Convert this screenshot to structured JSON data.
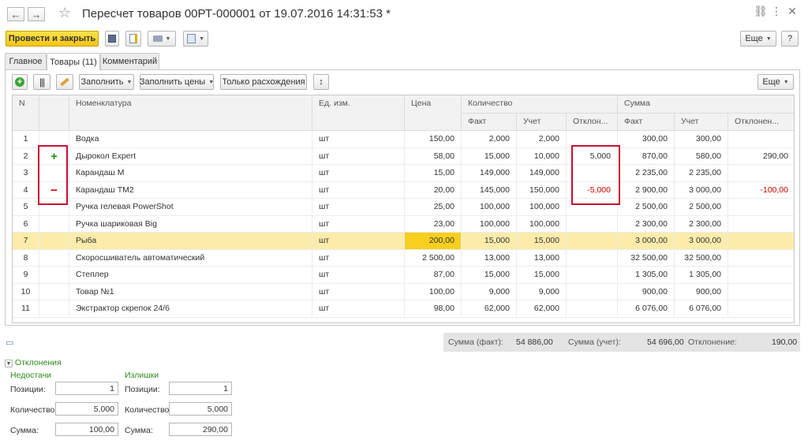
{
  "window": {
    "title": "Пересчет товаров 00РТ-000001 от 19.07.2016 14:31:53 *",
    "icons": [
      "link-icon",
      "menu-icon",
      "close-icon"
    ]
  },
  "toolbar": {
    "post_close": "Провести и закрыть",
    "more": "Еще",
    "help": "?"
  },
  "tabs": [
    {
      "label": "Главное",
      "active": false
    },
    {
      "label": "Товары (11)",
      "active": true
    },
    {
      "label": "Комментарий",
      "active": false
    }
  ],
  "table_toolbar": {
    "fill": "Заполнить",
    "fill_prices": "Заполнить цены",
    "only_diff": "Только расхождения",
    "more": "Еще"
  },
  "table": {
    "headers": {
      "n": "N",
      "nom": "Номенклатура",
      "unit": "Ед. изм.",
      "price": "Цена",
      "qty": "Количество",
      "qty_fact": "Факт",
      "qty_acc": "Учет",
      "qty_dev": "Отклон...",
      "sum": "Сумма",
      "sum_fact": "Факт",
      "sum_acc": "Учет",
      "sum_dev": "Отклонен..."
    },
    "rows": [
      {
        "n": "1",
        "mark": "",
        "nom": "Водка",
        "unit": "шт",
        "price": "150,00",
        "qf": "2,000",
        "qa": "2,000",
        "qd": "",
        "sf": "300,00",
        "sa": "300,00",
        "sd": ""
      },
      {
        "n": "2",
        "mark": "+",
        "nom": "Дырокол Expert",
        "unit": "шт",
        "price": "58,00",
        "qf": "15,000",
        "qa": "10,000",
        "qd": "5,000",
        "sf": "870,00",
        "sa": "580,00",
        "sd": "290,00"
      },
      {
        "n": "3",
        "mark": "",
        "nom": "Карандаш М",
        "unit": "шт",
        "price": "15,00",
        "qf": "149,000",
        "qa": "149,000",
        "qd": "",
        "sf": "2 235,00",
        "sa": "2 235,00",
        "sd": ""
      },
      {
        "n": "4",
        "mark": "−",
        "nom": "Карандаш ТМ2",
        "unit": "шт",
        "price": "20,00",
        "qf": "145,000",
        "qa": "150,000",
        "qd": "-5,000",
        "sf": "2 900,00",
        "sa": "3 000,00",
        "sd": "-100,00"
      },
      {
        "n": "5",
        "mark": "",
        "nom": "Ручка гелевая PowerShot",
        "unit": "шт",
        "price": "25,00",
        "qf": "100,000",
        "qa": "100,000",
        "qd": "",
        "sf": "2 500,00",
        "sa": "2 500,00",
        "sd": ""
      },
      {
        "n": "6",
        "mark": "",
        "nom": "Ручка шариковая Big",
        "unit": "шт",
        "price": "23,00",
        "qf": "100,000",
        "qa": "100,000",
        "qd": "",
        "sf": "2 300,00",
        "sa": "2 300,00",
        "sd": ""
      },
      {
        "n": "7",
        "mark": "",
        "nom": "Рыба",
        "unit": "шт",
        "price": "200,00",
        "qf": "15,000",
        "qa": "15,000",
        "qd": "",
        "sf": "3 000,00",
        "sa": "3 000,00",
        "sd": ""
      },
      {
        "n": "8",
        "mark": "",
        "nom": "Скоросшиватель автоматический",
        "unit": "шт",
        "price": "2 500,00",
        "qf": "13,000",
        "qa": "13,000",
        "qd": "",
        "sf": "32 500,00",
        "sa": "32 500,00",
        "sd": ""
      },
      {
        "n": "9",
        "mark": "",
        "nom": "Степлер",
        "unit": "шт",
        "price": "87,00",
        "qf": "15,000",
        "qa": "15,000",
        "qd": "",
        "sf": "1 305,00",
        "sa": "1 305,00",
        "sd": ""
      },
      {
        "n": "10",
        "mark": "",
        "nom": "Товар №1",
        "unit": "шт",
        "price": "100,00",
        "qf": "9,000",
        "qa": "9,000",
        "qd": "",
        "sf": "900,00",
        "sa": "900,00",
        "sd": ""
      },
      {
        "n": "11",
        "mark": "",
        "nom": "Экстрактор скрепок 24/6",
        "unit": "шт",
        "price": "98,00",
        "qf": "62,000",
        "qa": "62,000",
        "qd": "",
        "sf": "6 076,00",
        "sa": "6 076,00",
        "sd": ""
      }
    ]
  },
  "totals": {
    "fact_label": "Сумма (факт):",
    "fact_value": "54 886,00",
    "acc_label": "Сумма (учет):",
    "acc_value": "54 696,00",
    "dev_label": "Отклонение:",
    "dev_value": "190,00"
  },
  "deviations": {
    "title": "Отклонения",
    "shortage": {
      "title": "Недостачи",
      "positions_label": "Позиции:",
      "positions": "1",
      "qty_label": "Количество:",
      "qty": "5,000",
      "sum_label": "Сумма:",
      "sum": "100,00"
    },
    "surplus": {
      "title": "Излишки",
      "positions_label": "Позиции:",
      "positions": "1",
      "qty_label": "Количество:",
      "qty": "5,000",
      "sum_label": "Сумма:",
      "sum": "290,00"
    }
  }
}
